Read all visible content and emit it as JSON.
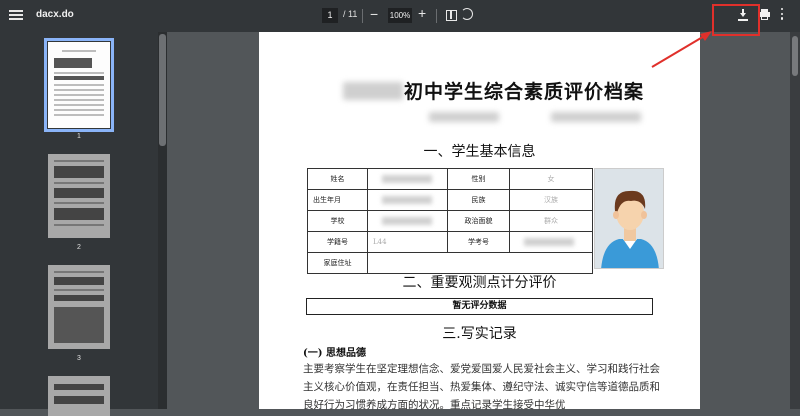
{
  "toolbar": {
    "title": "dacx.do",
    "page_current": "1",
    "page_total": "/ 11",
    "zoom_minus": "−",
    "zoom": "100%",
    "zoom_plus": "+"
  },
  "icons": {
    "menu": "menu-icon",
    "fit": "fit-to-page-icon",
    "rotate": "rotate-icon",
    "download": "download-icon",
    "print": "print-icon",
    "more": "more-vert-icon"
  },
  "accent_colors": {
    "highlight": "#e0302b",
    "active_thumb": "#8ab4f8"
  },
  "thumbnails": [
    {
      "number": "1"
    },
    {
      "number": "2"
    },
    {
      "number": "3"
    }
  ],
  "document": {
    "title": "初中学生综合素质评价档案",
    "section1": "一、学生基本信息",
    "table": {
      "name_label": "姓名",
      "gender_label": "性别",
      "gender_value": "女",
      "birth_label": "出生年月",
      "ethnicity_label": "民族",
      "ethnicity_value": "汉族",
      "school_label": "学校",
      "political_label": "政治面貌",
      "political_value": "群众",
      "student_id_label": "学籍号",
      "student_id_value": "L44",
      "exam_id_label": "学考号",
      "address_label": "家庭住址"
    },
    "section2": "二、重要观测点计分评价",
    "no_score": "暂无评分数据",
    "section3": "三.写实记录",
    "sub1": "(一) 思想品德",
    "paragraph": "主要考察学生在坚定理想信念、爱党爱国爱人民爱社会主义、学习和践行社会主义核心价值观，在责任担当、热爱集体、遵纪守法、诚实守信等道德品质和良好行为习惯养成方面的状况。重点记录学生接受中华优"
  }
}
